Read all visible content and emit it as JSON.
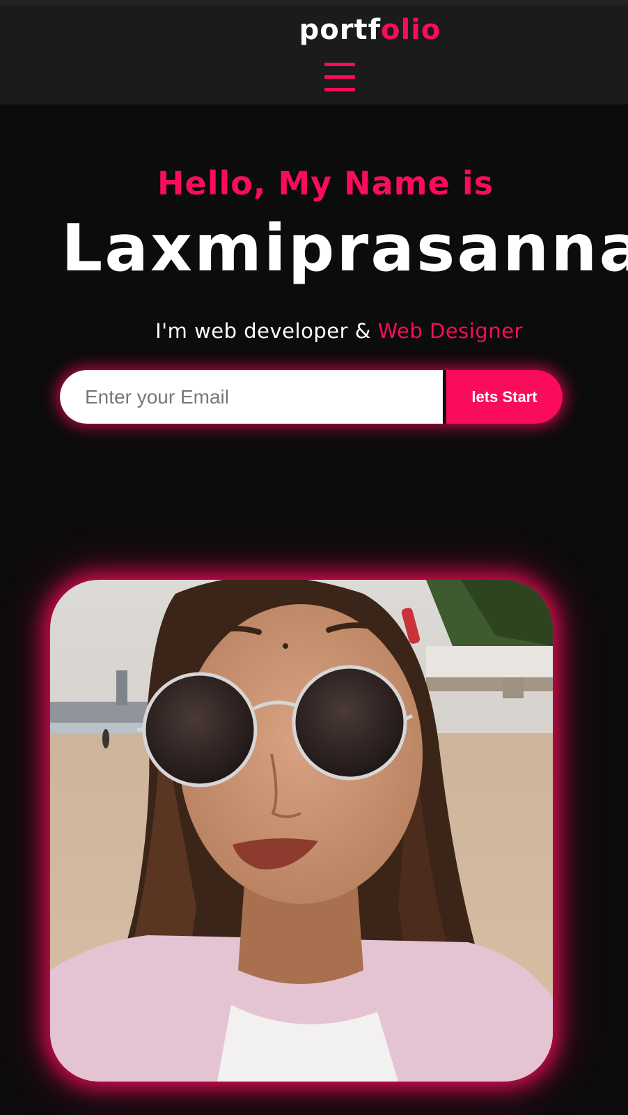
{
  "header": {
    "logo_main": "portf",
    "logo_accent": "olio"
  },
  "hero": {
    "greeting": "Hello, My Name is",
    "name": "Laxmiprasanna",
    "role_prefix": "I'm web developer &",
    "role_accent": "Web Designer"
  },
  "signup": {
    "email_placeholder": "Enter your Email",
    "button_label": "lets Start"
  },
  "icons": {
    "menu": "hamburger-menu-icon"
  },
  "colors": {
    "accent": "#fb0c5a",
    "background": "#0c0b0d",
    "header_bg": "#1b1a1c"
  }
}
